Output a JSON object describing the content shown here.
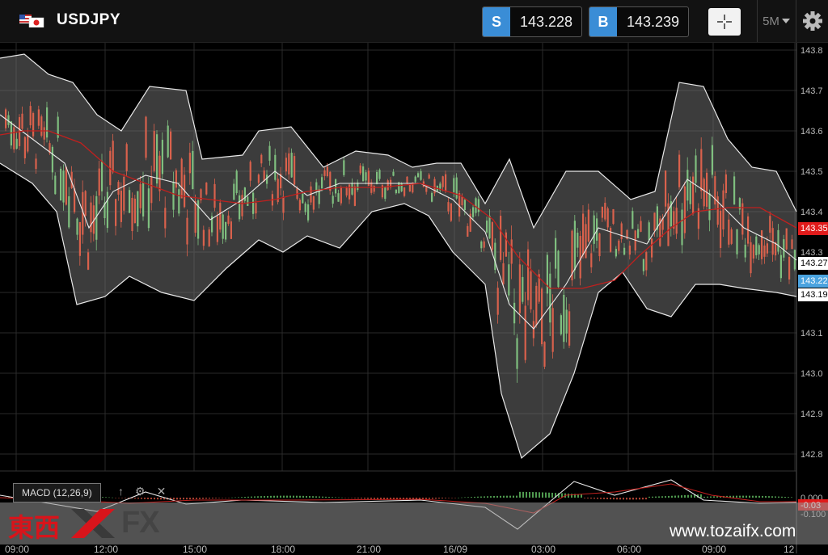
{
  "header": {
    "symbol": "USDJPY",
    "sell": {
      "tag": "S",
      "value": "143.228"
    },
    "buy": {
      "tag": "B",
      "value": "143.239"
    },
    "timeframe": "5M",
    "icons": {
      "flag": "us-jp-flag-icon",
      "crosshair": "crosshair-icon",
      "dropdown": "caret-down-icon",
      "settings": "gear-icon"
    }
  },
  "chart_data": {
    "type": "candlestick",
    "y_ticks": [
      "143.8",
      "143.7",
      "143.6",
      "143.5",
      "143.4",
      "143.3",
      "143.2",
      "143.1",
      "143.0",
      "142.9",
      "142.8"
    ],
    "ylim": [
      142.77,
      143.84
    ],
    "x_ticks": [
      "09:00",
      "12:00",
      "15:00",
      "18:00",
      "21:00",
      "16/09",
      "03:00",
      "06:00",
      "09:00",
      "12"
    ],
    "indicators": [
      "Bollinger Bands",
      "Moving Average",
      "MACD (12,26,9)"
    ],
    "price_tags": [
      {
        "label": "143.35",
        "color": "#e01b1b"
      },
      {
        "label": "143.27",
        "color": "#ffffff"
      },
      {
        "label": "143.22",
        "color": "#4aa3df"
      },
      {
        "label": "143.19",
        "color": "#ffffff"
      }
    ],
    "macd": {
      "label": "MACD (12,26,9)",
      "ticks": [
        "0.000",
        "-0.100"
      ],
      "tag": "-0.03"
    }
  },
  "macd_tools": {
    "up": "↑",
    "gear": "⚙",
    "close": "✕"
  },
  "watermark": {
    "kanji": "東西",
    "fx": "FX",
    "url": "www.tozaifx.com"
  }
}
